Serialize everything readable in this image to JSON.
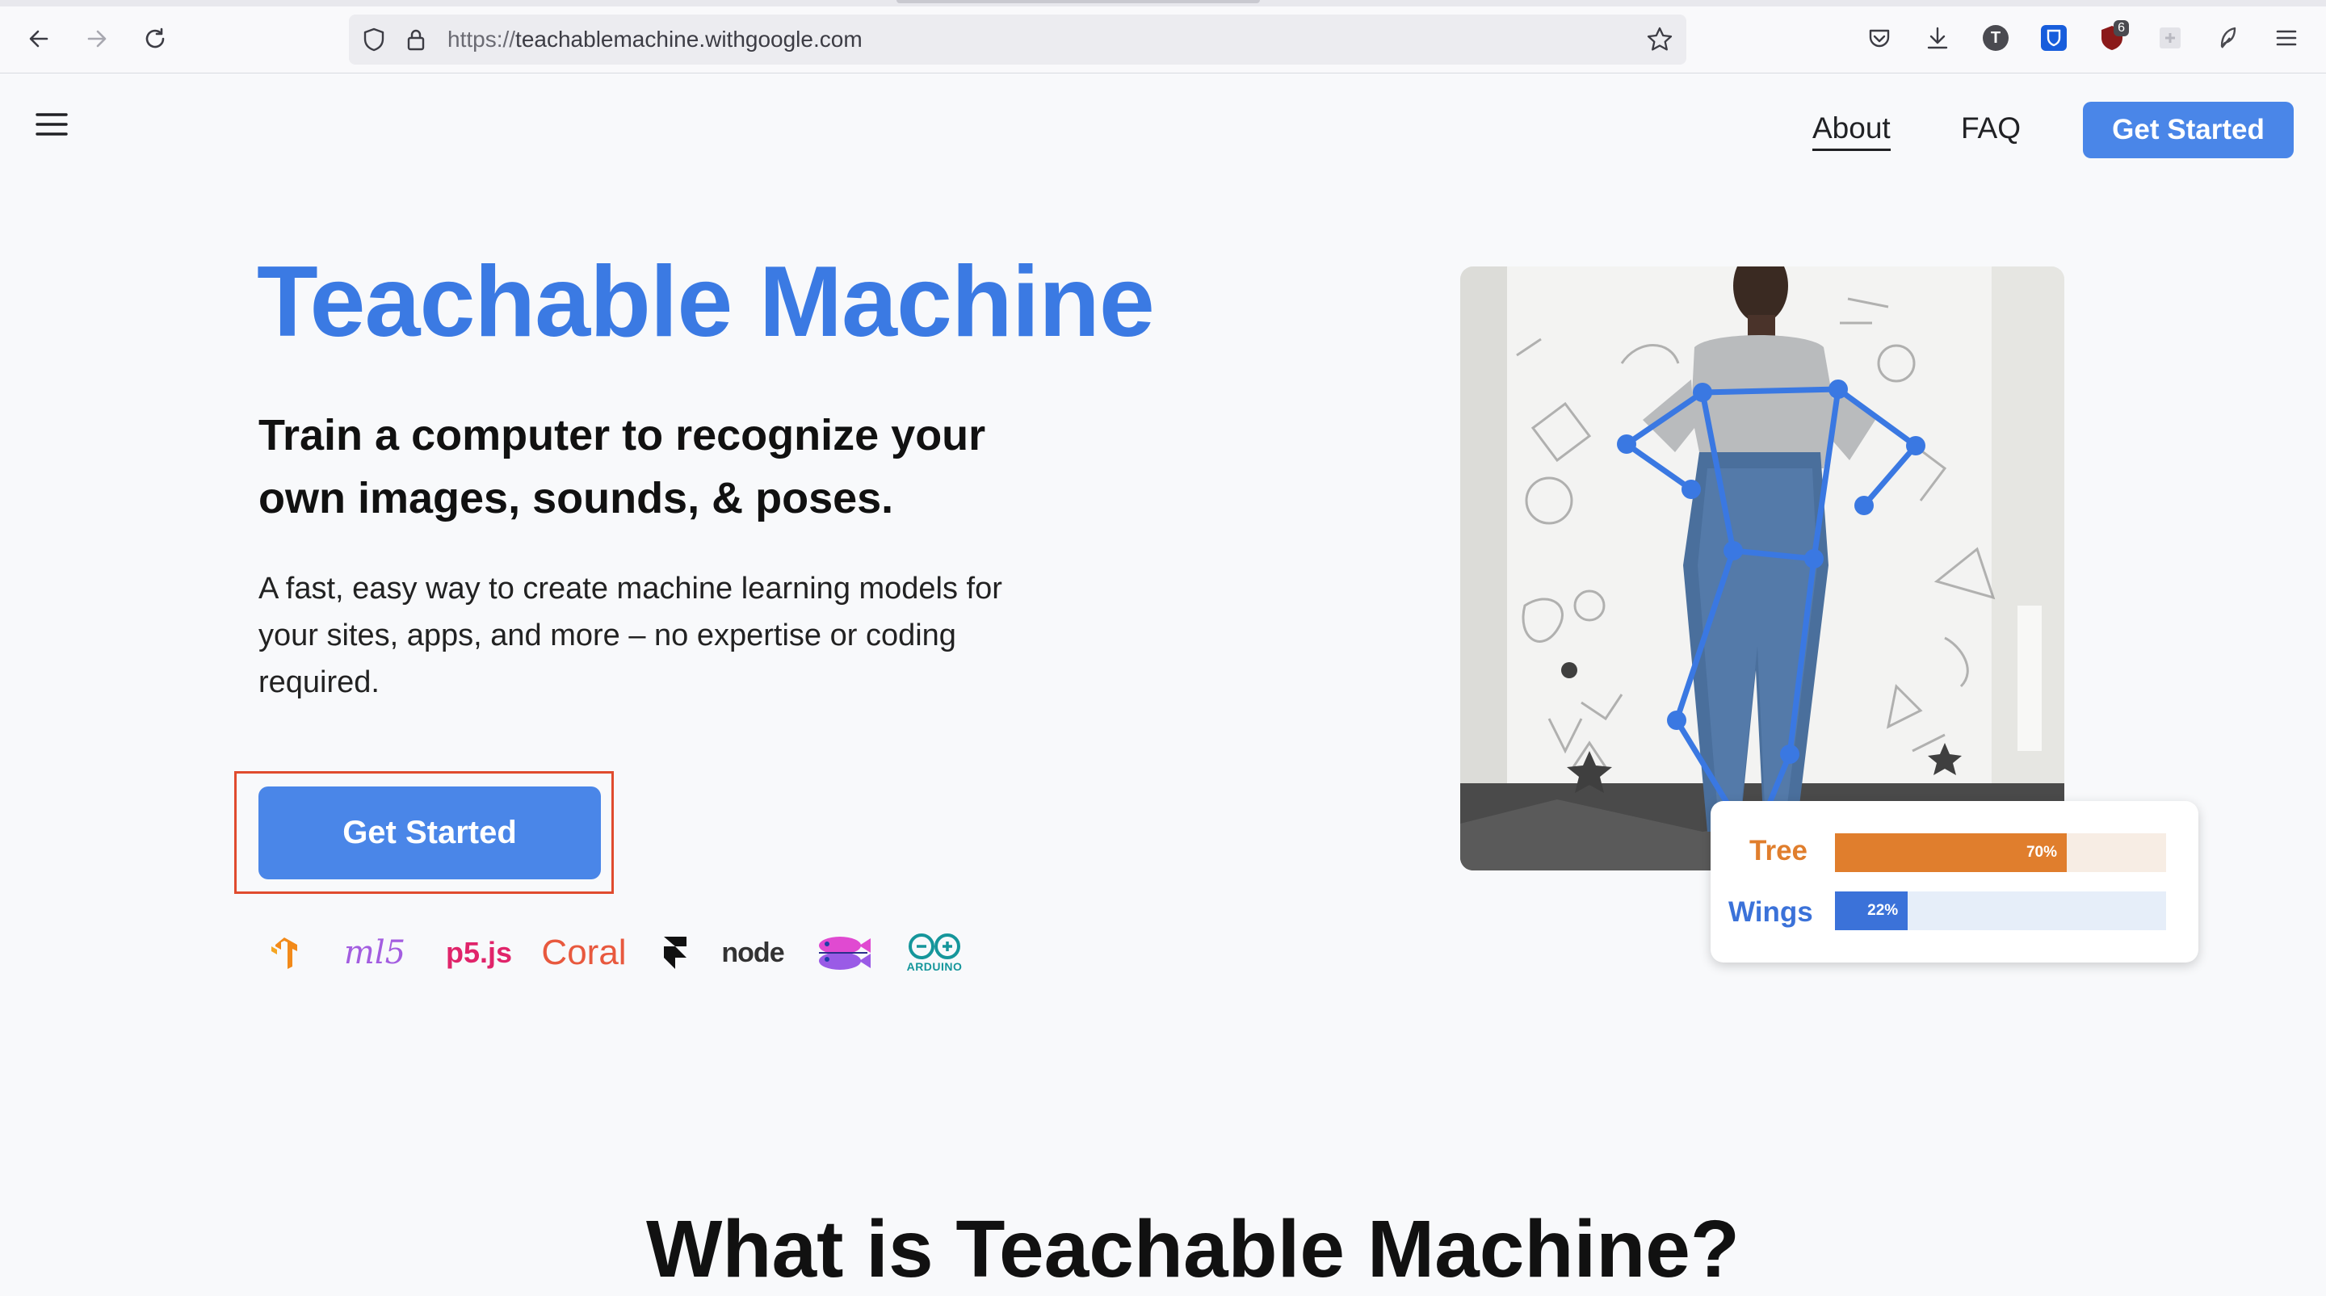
{
  "browser": {
    "url_scheme": "https://",
    "url_host": "teachablemachine.withgoogle.com",
    "extension_badge": "6",
    "profile_letter": "T"
  },
  "nav": {
    "about": "About",
    "faq": "FAQ",
    "get_started": "Get Started"
  },
  "hero": {
    "title": "Teachable Machine",
    "subtitle": "Train a computer to recognize your own images, sounds, & poses.",
    "description": "A fast, easy way to create machine learning models for your sites, apps, and more – no expertise or coding required.",
    "cta": "Get Started"
  },
  "logos": [
    {
      "name": "tensorflow-logo"
    },
    {
      "name": "ml5-logo",
      "text": "ml5"
    },
    {
      "name": "p5js-logo",
      "text": "p5.js"
    },
    {
      "name": "coral-logo",
      "text": "Coral"
    },
    {
      "name": "framer-logo"
    },
    {
      "name": "node-logo",
      "text": "node"
    },
    {
      "name": "glitch-fish-logo"
    },
    {
      "name": "arduino-logo",
      "text": "ARDUINO"
    }
  ],
  "predictions": [
    {
      "label": "Tree",
      "value": 0.7,
      "display": "70%",
      "color": "#e07e2d",
      "track": "#f7ede4"
    },
    {
      "label": "Wings",
      "value": 0.22,
      "display": "22%",
      "color": "#3b72d9",
      "track": "#e6eef9"
    }
  ],
  "bottom_heading": "What is Teachable Machine?",
  "colors": {
    "accent": "#4a86e8",
    "title": "#3b7ae3",
    "highlight_box": "#e04b2e"
  }
}
